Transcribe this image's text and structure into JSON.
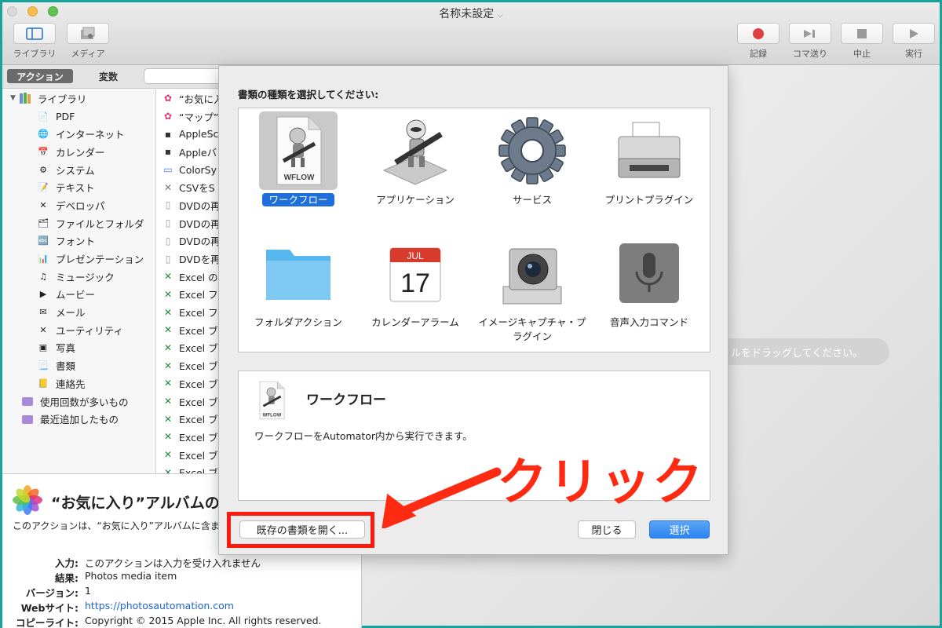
{
  "window": {
    "title": "名称未設定"
  },
  "toolbar": {
    "library": "ライブラリ",
    "media": "メディア",
    "record": "記録",
    "step": "コマ送り",
    "stop": "中止",
    "run": "実行"
  },
  "segments": {
    "actions": "アクション",
    "variables": "変数"
  },
  "library": {
    "root": "ライブラリ",
    "items": [
      "PDF",
      "インターネット",
      "カレンダー",
      "システム",
      "テキスト",
      "デベロッパ",
      "ファイルとフォルダ",
      "フォント",
      "プレゼンテーション",
      "ミュージック",
      "ムービー",
      "メール",
      "ユーティリティ",
      "写真",
      "書類",
      "連絡先"
    ],
    "smart": [
      "使用回数が多いもの",
      "最近追加したもの"
    ]
  },
  "actions": [
    "“お気に入",
    "“マップ”",
    "AppleSc",
    "Appleバ",
    "ColorSy",
    "CSVをS",
    "DVDの再",
    "DVDの再",
    "DVDの再",
    "DVDを再",
    "Excel の",
    "Excel フ",
    "Excel フ",
    "Excel ブ",
    "Excel ブ",
    "Excel ブ",
    "Excel ブ",
    "Excel ブ",
    "Excel ブ",
    "Excel ブ",
    "Excel ブ",
    "Excel ブ"
  ],
  "description": {
    "title": "“お気に入り”アルバムの",
    "body": "このアクションは、“お気に入り”アルバムに含まれる写真を返します。",
    "meta": [
      {
        "key": "入力:",
        "value": "このアクションは入力を受け入れません"
      },
      {
        "key": "結果:",
        "value": "Photos media item"
      },
      {
        "key": "バージョン:",
        "value": "1"
      },
      {
        "key": "Webサイト:",
        "value": "https://photosautomation.com"
      },
      {
        "key": "コピーライト:",
        "value": "Copyright © 2015 Apple Inc. All rights reserved."
      }
    ]
  },
  "workflow": {
    "hint": "ルをドラッグしてください。"
  },
  "sheet": {
    "prompt": "書類の種類を選択してください:",
    "types": [
      {
        "label": "ワークフロー",
        "icon": "workflow-icon"
      },
      {
        "label": "アプリケーション",
        "icon": "automator-robot-icon"
      },
      {
        "label": "サービス",
        "icon": "gear-icon"
      },
      {
        "label": "プリントプラグイン",
        "icon": "printer-icon"
      },
      {
        "label": "フォルダアクション",
        "icon": "folder-icon"
      },
      {
        "label": "カレンダーアラーム",
        "icon": "calendar-icon"
      },
      {
        "label": "イメージキャプチャ・プラグイン",
        "icon": "camera-icon"
      },
      {
        "label": "音声入力コマンド",
        "icon": "microphone-icon"
      }
    ],
    "calendar_month": "JUL",
    "calendar_day": "17",
    "wflow_badge": "WFLOW",
    "info_title": "ワークフロー",
    "info_desc": "ワークフローをAutomator内から実行できます。",
    "open_existing": "既存の書類を開く...",
    "close": "閉じる",
    "select": "選択"
  },
  "annotation": {
    "text": "クリック",
    "color": "#ff2a12"
  }
}
